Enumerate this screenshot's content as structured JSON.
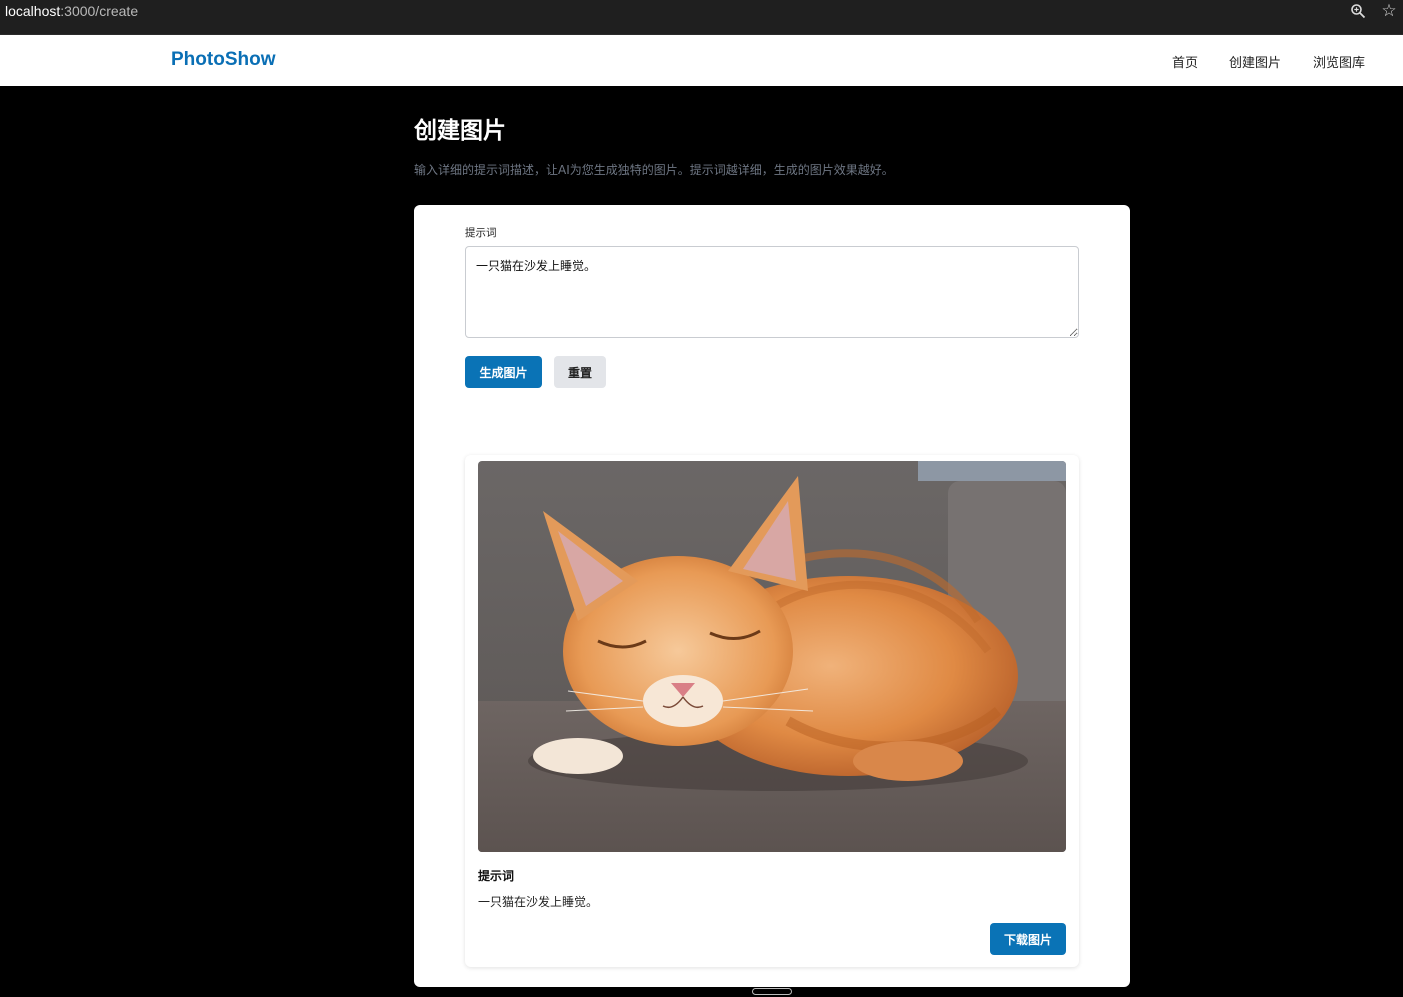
{
  "browser": {
    "url_host": "localhost",
    "url_path": ":3000/create",
    "zoom_icon": "magnifier-zoom-icon",
    "bookmark_icon": "star-icon"
  },
  "navbar": {
    "brand": "PhotoShow",
    "links": [
      {
        "label": "首页"
      },
      {
        "label": "创建图片"
      },
      {
        "label": "浏览图库"
      }
    ]
  },
  "page": {
    "title": "创建图片",
    "description": "输入详细的提示词描述，让AI为您生成独特的图片。提示词越详细，生成的图片效果越好。"
  },
  "form": {
    "prompt_label": "提示词",
    "prompt_value": "一只猫在沙发上睡觉。",
    "generate_label": "生成图片",
    "reset_label": "重置"
  },
  "result": {
    "image_alt": "orange tabby cat sleeping on a grey sofa",
    "prompt_heading": "提示词",
    "prompt_text": "一只猫在沙发上睡觉。",
    "download_label": "下载图片"
  },
  "colors": {
    "brand": "#0a6fb5",
    "primary_button": "#0a73b6",
    "secondary_button": "#e3e5e9",
    "page_background": "#000000"
  }
}
